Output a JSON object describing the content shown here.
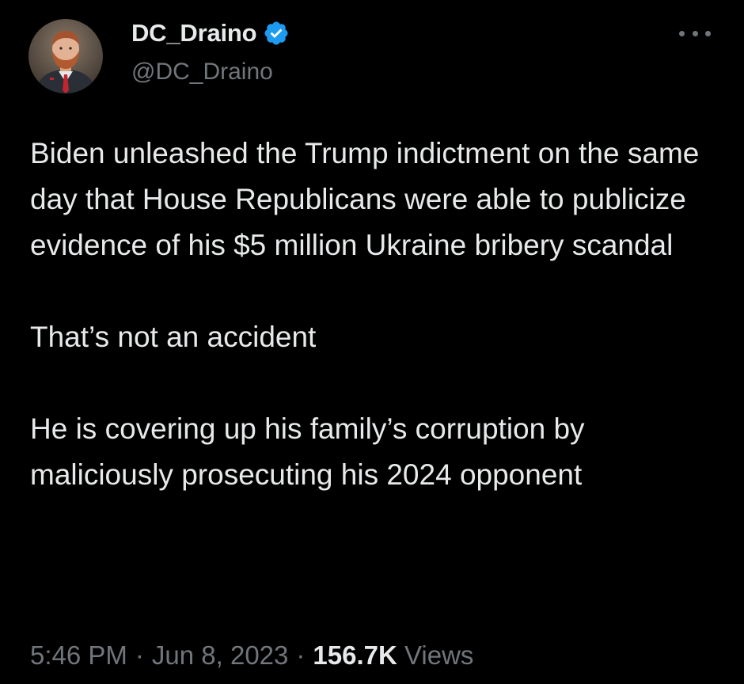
{
  "user": {
    "display_name": "DC_Draino",
    "handle": "@DC_Draino",
    "verified_icon": "verified-badge-icon",
    "verified_color": "#1d9bf0"
  },
  "tweet": {
    "paragraphs": [
      "Biden unleashed the Trump indictment on the same day that House Republicans were able to publicize evidence of his $5 million Ukraine bribery scandal",
      "That’s not an accident",
      "He is covering up his family’s corruption by maliciously prosecuting his 2024 opponent"
    ],
    "time": "5:46 PM",
    "date": "Jun 8, 2023",
    "separator": "·",
    "views_count": "156.7K",
    "views_label": "Views"
  },
  "icons": {
    "more": "more-horizontal-icon"
  },
  "colors": {
    "background": "#000000",
    "primary_text": "#e7e9ea",
    "secondary_text": "#71767b",
    "accent": "#1d9bf0"
  }
}
